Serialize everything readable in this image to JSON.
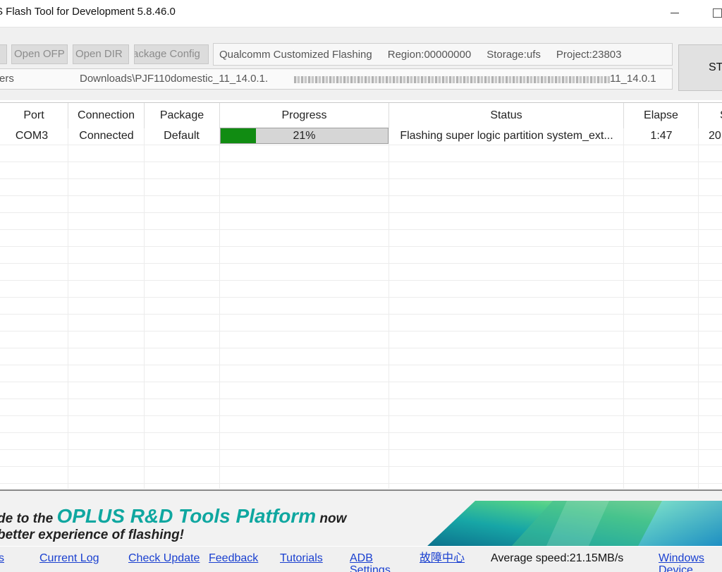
{
  "window": {
    "title": "S Flash Tool for Development 5.8.46.0"
  },
  "toolbar": {
    "left_button": "",
    "open_ofp": "Open OFP",
    "open_dir": "Open DIR",
    "package_config": "ackage Config",
    "info": {
      "mode": "Qualcomm Customized Flashing",
      "region": "Region:00000000",
      "storage": "Storage:ufs",
      "project": "Project:23803"
    },
    "path": {
      "start": "ers",
      "mid": "Downloads\\PJF110domestic_11_14.0.1.",
      "end": "11_14.0.1"
    },
    "start_button": "ST"
  },
  "table": {
    "headers": {
      "id": "",
      "port": "Port",
      "connection": "Connection",
      "package": "Package",
      "progress": "Progress",
      "status": "Status",
      "elapse": "Elapse",
      "speed": "S"
    },
    "rows": [
      {
        "port": "COM3",
        "connection": "Connected",
        "package": "Default",
        "progress_percent": 21,
        "progress_label": "21%",
        "status": "Flashing super logic partition system_ext...",
        "elapse": "1:47",
        "speed": "20"
      }
    ]
  },
  "banner": {
    "line1_prefix": "de to the ",
    "brand": "OPLUS R&D Tools Platform",
    "line1_suffix": " now",
    "line2": "better experience of flashing!"
  },
  "statusbar": {
    "links": {
      "first": "s",
      "current_log": "Current Log",
      "check_update": "Check Update",
      "feedback": "Feedback",
      "tutorials": "Tutorials",
      "adb_settings": "ADB Settings",
      "fault_center": "故障中心",
      "windows_manager": "Windows Device Manager"
    },
    "average_speed": "Average speed:21.15MB/s"
  },
  "colors": {
    "progress_fill": "#118c12",
    "brand_teal": "#0fa7a0",
    "link_blue": "#1a40d0"
  }
}
